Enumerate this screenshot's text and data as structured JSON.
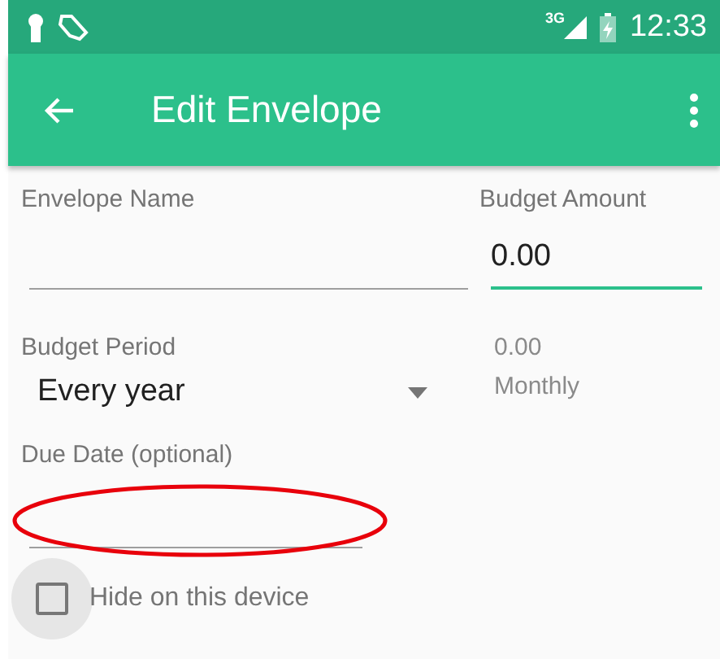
{
  "status_bar": {
    "network": "3G",
    "time": "12:33"
  },
  "app_bar": {
    "title": "Edit Envelope"
  },
  "form": {
    "envelope_name": {
      "label": "Envelope Name"
    },
    "budget_amount": {
      "label": "Budget Amount",
      "value": "0.00"
    },
    "budget_period": {
      "label": "Budget Period",
      "value": "Every year"
    },
    "summary": {
      "amount": "0.00",
      "period": "Monthly"
    },
    "due_date": {
      "label": "Due Date (optional)"
    },
    "hide_checkbox": {
      "label": "Hide on this device",
      "checked": false
    }
  }
}
